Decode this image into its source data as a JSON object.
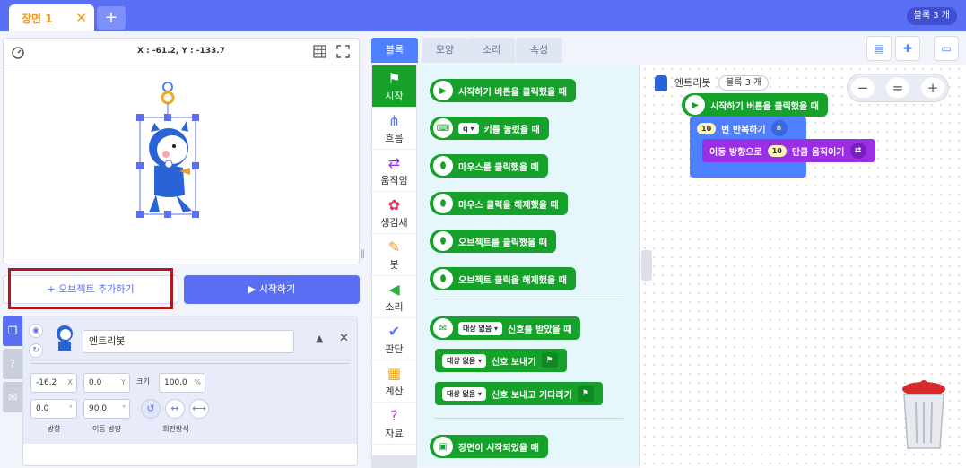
{
  "topbar": {
    "scene_tab_label": "장면 1",
    "scene_close": "✕",
    "add_scene": "+",
    "block_count": "블록 3 개"
  },
  "stage": {
    "coords": "X : -61.2,  Y : -133.7"
  },
  "buttons": {
    "add_object": "+ 오브젝트 추가하기",
    "start": "▶ 시작하기"
  },
  "object": {
    "name": "엔트리봇",
    "x_value": "-16.2",
    "x_unit": "X",
    "y_value": "0.0",
    "y_unit": "Y",
    "size_label": "크기",
    "size_value": "100.0",
    "size_unit": "%",
    "direction_value": "0.0",
    "direction_unit": "°",
    "move_direction_value": "90.0",
    "move_direction_unit": "°",
    "direction_label": "방향",
    "move_direction_label": "이동 방향",
    "rotation_label": "회전방식"
  },
  "tabs": [
    "블록",
    "모양",
    "소리",
    "속성"
  ],
  "categories": [
    {
      "label": "시작",
      "icon": "⚑"
    },
    {
      "label": "흐름",
      "icon": "⋔"
    },
    {
      "label": "움직임",
      "icon": "⇄"
    },
    {
      "label": "생김새",
      "icon": "✿"
    },
    {
      "label": "붓",
      "icon": "✎"
    },
    {
      "label": "소리",
      "icon": "◀"
    },
    {
      "label": "판단",
      "icon": "✔"
    },
    {
      "label": "계산",
      "icon": "▦"
    },
    {
      "label": "자료",
      "icon": "?"
    }
  ],
  "palette": {
    "b1": "시작하기 버튼을 클릭했을 때",
    "b2_key": "q ▾",
    "b2": "키를 눌렀을 때",
    "b3": "마우스를 클릭했을 때",
    "b4": "마우스 클릭을 해제했을 때",
    "b5": "오브젝트를 클릭했을 때",
    "b6": "오브젝트 클릭을 해제했을 때",
    "b7_drop": "대상 없음 ▾",
    "b7": "신호를 받았을 때",
    "b8_drop": "대상 없음 ▾",
    "b8": "신호 보내기",
    "b9_drop": "대상 없음 ▾",
    "b9": "신호 보내고 기다리기",
    "b10": "장면이 시작되었을 때"
  },
  "workspace": {
    "object_name": "엔트리봇",
    "block_count": "블록 3 개",
    "script_start": "시작하기 버튼을 클릭했을 때",
    "repeat_count": "10",
    "repeat_label": "번 반복하기",
    "move_label_a": "이동 방향으로",
    "move_value": "10",
    "move_label_b": "만큼 움직이기",
    "zoom_out": "−",
    "zoom_reset": "=",
    "zoom_in": "+"
  }
}
